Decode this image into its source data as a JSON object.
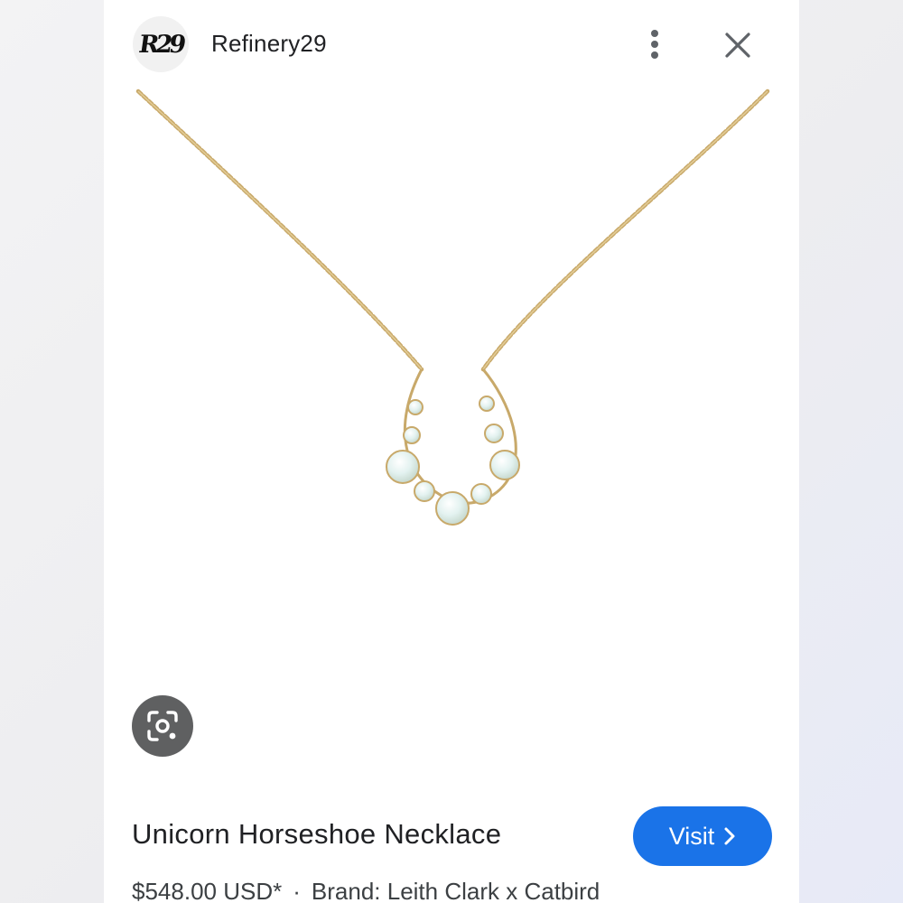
{
  "header": {
    "logo_text": "R29",
    "source_name": "Refinery29",
    "icons": {
      "more": "more-vert-icon",
      "close": "close-icon"
    }
  },
  "image": {
    "subject": "necklace-image",
    "colors": {
      "chain": "#c8a96a",
      "stone": "#dfeff0"
    }
  },
  "lens": {
    "icon": "lens-camera-icon"
  },
  "product": {
    "title": "Unicorn Horseshoe Necklace",
    "price": "$548.00 USD*",
    "separator": "·",
    "brand": "Brand: Leith Clark x Catbird"
  },
  "actions": {
    "visit_label": "Visit",
    "visit_icon": "chevron-right-icon"
  },
  "colors": {
    "accent": "#1a73e8",
    "lens_bg": "#5f6061",
    "text": "#202124"
  }
}
